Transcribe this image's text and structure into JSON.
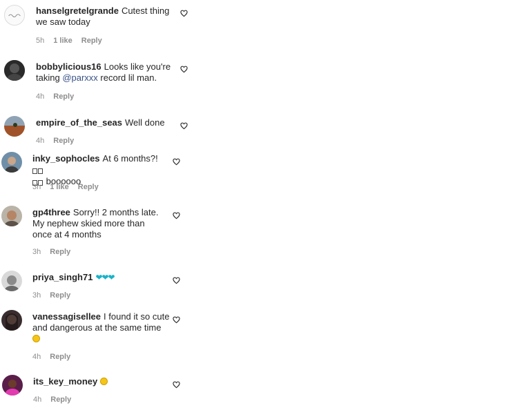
{
  "comments": [
    {
      "user": "hanselgretelgrande",
      "text": "Cutest thing we saw today",
      "time": "5h",
      "likes": "1 like",
      "reply": "Reply"
    },
    {
      "user": "bobbylicious16",
      "text_before": "Looks like you're taking ",
      "mention": "@parxxx",
      "text_after": " record lil man.",
      "time": "4h",
      "reply": "Reply"
    },
    {
      "user": "empire_of_the_seas",
      "text": "Well done",
      "time": "4h",
      "reply": "Reply"
    },
    {
      "user": "inky_sophocles",
      "text": "At 6 months?!",
      "text2": "boooooo",
      "time": "3h",
      "likes": "1 like",
      "reply": "Reply"
    },
    {
      "user": "gp4three",
      "text": "Sorry!! 2 months late. My nephew skied more than once at 4 months",
      "time": "3h",
      "reply": "Reply"
    },
    {
      "user": "priya_singh71",
      "text": "",
      "time": "3h",
      "reply": "Reply"
    },
    {
      "user": "vanessagisellee",
      "text": "I found it so cute and dangerous at the same time",
      "time": "4h",
      "reply": "Reply"
    },
    {
      "user": "its_key_money",
      "text": "",
      "time": "4h",
      "reply": "Reply"
    }
  ],
  "colors": {
    "username": "#262626",
    "meta": "#8e8e8e",
    "mention": "#385185",
    "heart_emoji": "#1ab2c8"
  },
  "icons": {
    "like": "heart-outline-icon"
  }
}
